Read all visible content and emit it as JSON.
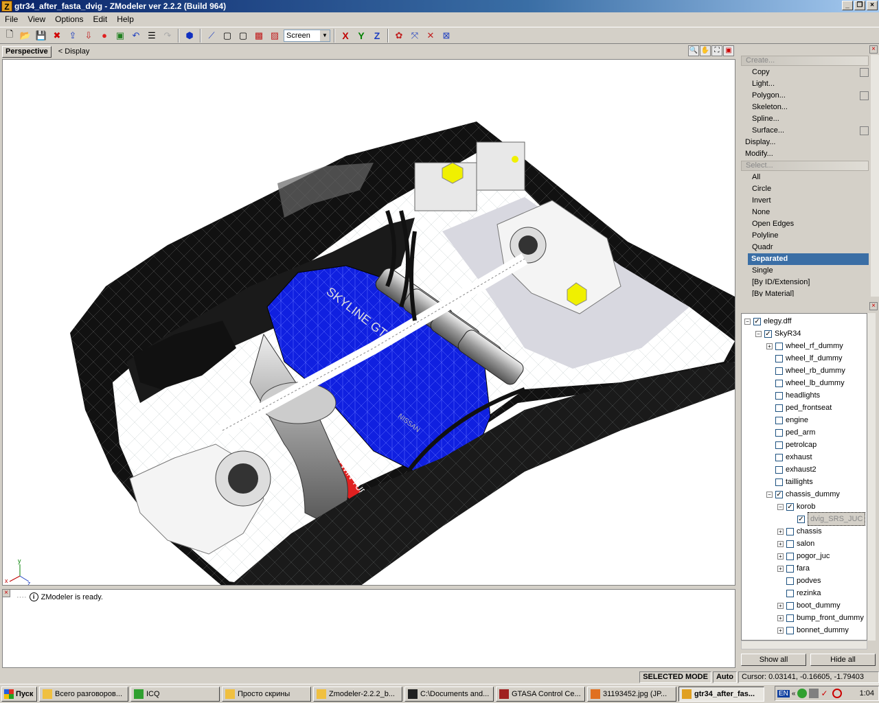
{
  "window": {
    "title": "gtr34_after_fasta_dvig - ZModeler ver 2.2.2 (Build 964)"
  },
  "menu": [
    "File",
    "View",
    "Options",
    "Edit",
    "Help"
  ],
  "toolbar": {
    "view_mode": "Screen",
    "axis_x": "X",
    "axis_y": "Y",
    "axis_z": "Z"
  },
  "viewport": {
    "tab": "Perspective",
    "display_label": "< Display",
    "engine_text_1": "SKYLINE GT-R",
    "engine_text_2": "NISSAN",
    "engine_text_3": "TWIN TURBO",
    "axis_labels": {
      "x": "x",
      "y": "y",
      "z": "z"
    }
  },
  "log": {
    "message": "ZModeler is ready."
  },
  "command_menu": {
    "items": [
      {
        "label": "Create...",
        "type": "header",
        "check": false
      },
      {
        "label": "Copy",
        "type": "item",
        "check": true
      },
      {
        "label": "Light...",
        "type": "item",
        "check": false
      },
      {
        "label": "Polygon...",
        "type": "item",
        "check": true
      },
      {
        "label": "Skeleton...",
        "type": "item",
        "check": false
      },
      {
        "label": "Spline...",
        "type": "item",
        "check": false
      },
      {
        "label": "Surface...",
        "type": "item",
        "check": true
      },
      {
        "label": "Display...",
        "type": "top",
        "check": false
      },
      {
        "label": "Modify...",
        "type": "top",
        "check": false
      },
      {
        "label": "Select...",
        "type": "header",
        "check": false
      },
      {
        "label": "All",
        "type": "item",
        "check": false
      },
      {
        "label": "Circle",
        "type": "item",
        "check": false
      },
      {
        "label": "Invert",
        "type": "item",
        "check": false
      },
      {
        "label": "None",
        "type": "item",
        "check": false
      },
      {
        "label": "Open Edges",
        "type": "item",
        "check": false
      },
      {
        "label": "Polyline",
        "type": "item",
        "check": false
      },
      {
        "label": "Quadr",
        "type": "item",
        "check": false
      },
      {
        "label": "Separated",
        "type": "selected",
        "check": false
      },
      {
        "label": "Single",
        "type": "item",
        "check": false
      },
      {
        "label": "[By ID/Extension]",
        "type": "item",
        "check": false
      },
      {
        "label": "[By Material]",
        "type": "item",
        "check": false
      }
    ]
  },
  "tree": {
    "nodes": [
      {
        "label": "elegy.dff",
        "depth": 0,
        "expander": "-",
        "checked": true
      },
      {
        "label": "SkyR34",
        "depth": 1,
        "expander": "-",
        "checked": true
      },
      {
        "label": "wheel_rf_dummy",
        "depth": 2,
        "expander": "+",
        "checked": false
      },
      {
        "label": "wheel_lf_dummy",
        "depth": 2,
        "expander": "",
        "checked": false
      },
      {
        "label": "wheel_rb_dummy",
        "depth": 2,
        "expander": "",
        "checked": false
      },
      {
        "label": "wheel_lb_dummy",
        "depth": 2,
        "expander": "",
        "checked": false
      },
      {
        "label": "headlights",
        "depth": 2,
        "expander": "",
        "checked": false
      },
      {
        "label": "ped_frontseat",
        "depth": 2,
        "expander": "",
        "checked": false
      },
      {
        "label": "engine",
        "depth": 2,
        "expander": "",
        "checked": false
      },
      {
        "label": "ped_arm",
        "depth": 2,
        "expander": "",
        "checked": false
      },
      {
        "label": "petrolcap",
        "depth": 2,
        "expander": "",
        "checked": false
      },
      {
        "label": "exhaust",
        "depth": 2,
        "expander": "",
        "checked": false
      },
      {
        "label": "exhaust2",
        "depth": 2,
        "expander": "",
        "checked": false
      },
      {
        "label": "taillights",
        "depth": 2,
        "expander": "",
        "checked": false
      },
      {
        "label": "chassis_dummy",
        "depth": 2,
        "expander": "-",
        "checked": true
      },
      {
        "label": "korob",
        "depth": 3,
        "expander": "-",
        "checked": true
      },
      {
        "label": "dvig_SRS_JUC",
        "depth": 4,
        "expander": "",
        "checked": true,
        "highlight": true
      },
      {
        "label": "chassis",
        "depth": 3,
        "expander": "+",
        "checked": false
      },
      {
        "label": "salon",
        "depth": 3,
        "expander": "+",
        "checked": false
      },
      {
        "label": "pogor_juc",
        "depth": 3,
        "expander": "+",
        "checked": false
      },
      {
        "label": "fara",
        "depth": 3,
        "expander": "+",
        "checked": false
      },
      {
        "label": "podves",
        "depth": 3,
        "expander": "",
        "checked": false
      },
      {
        "label": "rezinka",
        "depth": 3,
        "expander": "",
        "checked": false
      },
      {
        "label": "boot_dummy",
        "depth": 3,
        "expander": "+",
        "checked": false
      },
      {
        "label": "bump_front_dummy",
        "depth": 3,
        "expander": "+",
        "checked": false
      },
      {
        "label": "bonnet_dummy",
        "depth": 3,
        "expander": "+",
        "checked": false
      }
    ],
    "show_all": "Show all",
    "hide_all": "Hide all"
  },
  "status": {
    "mode": "SELECTED MODE",
    "auto": "Auto",
    "cursor": "Cursor: 0.03141, -0.16605, -1.79403"
  },
  "taskbar": {
    "start": "Пуск",
    "tasks": [
      {
        "label": "Всего разговоров...",
        "icon_color": "#f0c040",
        "active": false
      },
      {
        "label": "ICQ",
        "icon_color": "#30a030",
        "active": false
      },
      {
        "label": "Просто скрины",
        "icon_color": "#f0c040",
        "active": false
      },
      {
        "label": "Zmodeler-2.2.2_b...",
        "icon_color": "#f0c040",
        "active": false
      },
      {
        "label": "C:\\Documents and...",
        "icon_color": "#202020",
        "active": false
      },
      {
        "label": "GTASA Control Ce...",
        "icon_color": "#a02020",
        "active": false
      },
      {
        "label": "31193452.jpg (JP...",
        "icon_color": "#e07020",
        "active": false
      },
      {
        "label": "gtr34_after_fas...",
        "icon_color": "#e0a020",
        "active": true
      }
    ],
    "lang": "EN",
    "clock": "1:04"
  },
  "colors": {
    "engine_blue": "#1020e0",
    "selection": "#3a6ea5",
    "yellow_cap": "#f0f000"
  }
}
